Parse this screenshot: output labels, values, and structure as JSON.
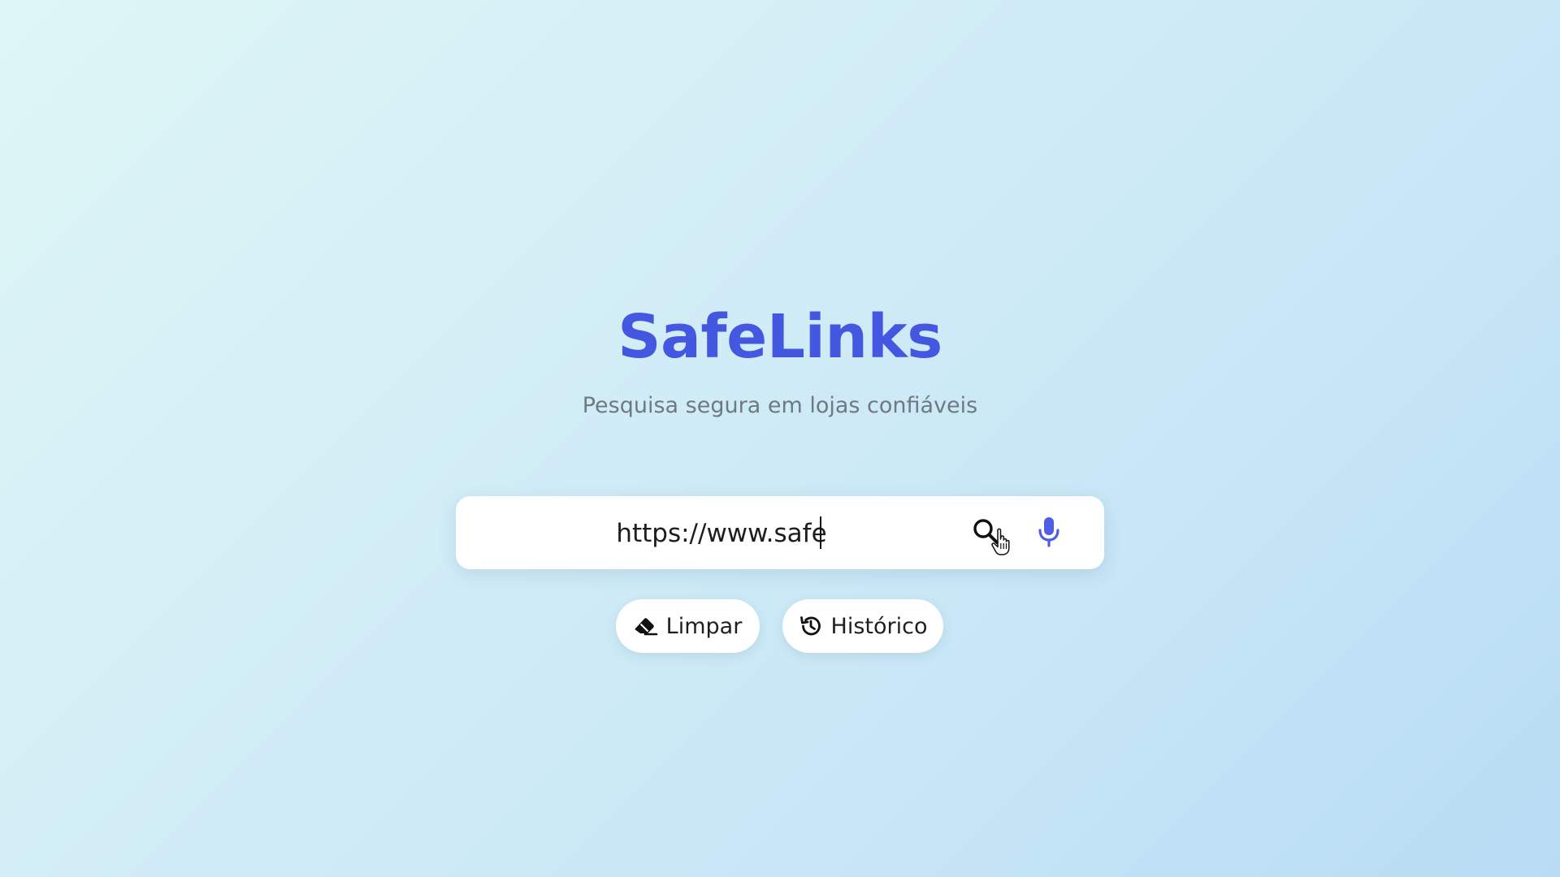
{
  "header": {
    "brand": "SafeLinks",
    "tagline": "Pesquisa segura em lojas confiáveis"
  },
  "search": {
    "value": "https://www.safe",
    "search_icon": "search-icon",
    "mic_icon": "microphone-icon"
  },
  "actions": {
    "clear_label": "Limpar",
    "clear_icon": "eraser-icon",
    "history_label": "Histórico",
    "history_icon": "history-icon"
  },
  "colors": {
    "brand": "#4357e0",
    "tagline": "#6f7a80",
    "background_start": "#dff6f6",
    "background_end": "#b9dcf5"
  }
}
